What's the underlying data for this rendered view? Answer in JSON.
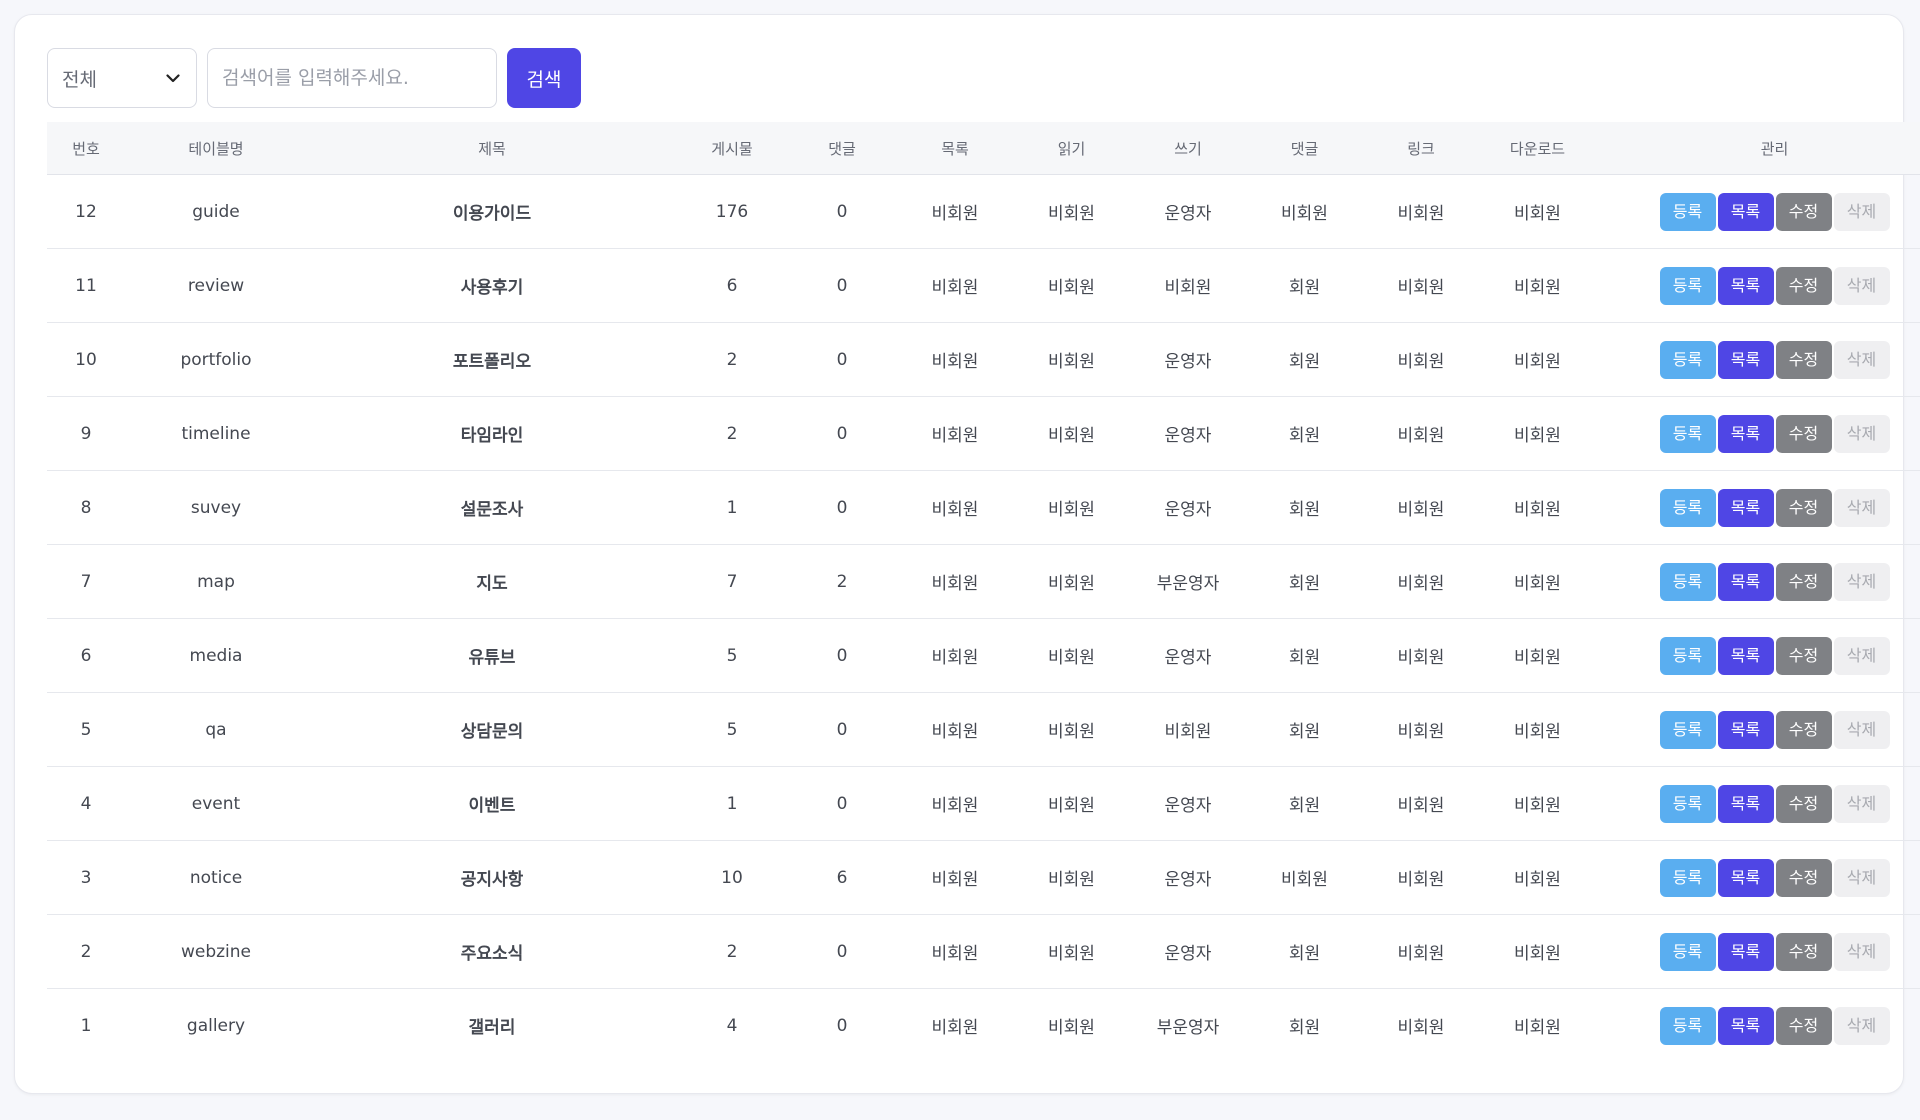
{
  "search": {
    "category_selected": "전체",
    "placeholder": "검색어를 입력해주세요.",
    "value": "",
    "button_label": "검색"
  },
  "table": {
    "headers": [
      "번호",
      "테이블명",
      "제목",
      "게시물",
      "댓글",
      "목록",
      "읽기",
      "쓰기",
      "댓글",
      "링크",
      "다운로드",
      "관리"
    ],
    "action_labels": {
      "register": "등록",
      "list": "목록",
      "edit": "수정",
      "delete": "삭제"
    },
    "rows": [
      {
        "no": "12",
        "table_name": "guide",
        "title": "이용가이드",
        "posts": "176",
        "comments": "0",
        "list": "비회원",
        "read": "비회원",
        "write": "운영자",
        "comment": "비회원",
        "link": "비회원",
        "download": "비회원"
      },
      {
        "no": "11",
        "table_name": "review",
        "title": "사용후기",
        "posts": "6",
        "comments": "0",
        "list": "비회원",
        "read": "비회원",
        "write": "비회원",
        "comment": "회원",
        "link": "비회원",
        "download": "비회원"
      },
      {
        "no": "10",
        "table_name": "portfolio",
        "title": "포트폴리오",
        "posts": "2",
        "comments": "0",
        "list": "비회원",
        "read": "비회원",
        "write": "운영자",
        "comment": "회원",
        "link": "비회원",
        "download": "비회원"
      },
      {
        "no": "9",
        "table_name": "timeline",
        "title": "타임라인",
        "posts": "2",
        "comments": "0",
        "list": "비회원",
        "read": "비회원",
        "write": "운영자",
        "comment": "회원",
        "link": "비회원",
        "download": "비회원"
      },
      {
        "no": "8",
        "table_name": "suvey",
        "title": "설문조사",
        "posts": "1",
        "comments": "0",
        "list": "비회원",
        "read": "비회원",
        "write": "운영자",
        "comment": "회원",
        "link": "비회원",
        "download": "비회원"
      },
      {
        "no": "7",
        "table_name": "map",
        "title": "지도",
        "posts": "7",
        "comments": "2",
        "list": "비회원",
        "read": "비회원",
        "write": "부운영자",
        "comment": "회원",
        "link": "비회원",
        "download": "비회원"
      },
      {
        "no": "6",
        "table_name": "media",
        "title": "유튜브",
        "posts": "5",
        "comments": "0",
        "list": "비회원",
        "read": "비회원",
        "write": "운영자",
        "comment": "회원",
        "link": "비회원",
        "download": "비회원"
      },
      {
        "no": "5",
        "table_name": "qa",
        "title": "상담문의",
        "posts": "5",
        "comments": "0",
        "list": "비회원",
        "read": "비회원",
        "write": "비회원",
        "comment": "회원",
        "link": "비회원",
        "download": "비회원"
      },
      {
        "no": "4",
        "table_name": "event",
        "title": "이벤트",
        "posts": "1",
        "comments": "0",
        "list": "비회원",
        "read": "비회원",
        "write": "운영자",
        "comment": "회원",
        "link": "비회원",
        "download": "비회원"
      },
      {
        "no": "3",
        "table_name": "notice",
        "title": "공지사항",
        "posts": "10",
        "comments": "6",
        "list": "비회원",
        "read": "비회원",
        "write": "운영자",
        "comment": "비회원",
        "link": "비회원",
        "download": "비회원"
      },
      {
        "no": "2",
        "table_name": "webzine",
        "title": "주요소식",
        "posts": "2",
        "comments": "0",
        "list": "비회원",
        "read": "비회원",
        "write": "운영자",
        "comment": "회원",
        "link": "비회원",
        "download": "비회원"
      },
      {
        "no": "1",
        "table_name": "gallery",
        "title": "갤러리",
        "posts": "4",
        "comments": "0",
        "list": "비회원",
        "read": "비회원",
        "write": "부운영자",
        "comment": "회원",
        "link": "비회원",
        "download": "비회원"
      }
    ]
  },
  "colors": {
    "accent": "#4f46e5",
    "register_button": "#5aaef0",
    "list_button": "#4f46e5",
    "edit_button": "#7f8185",
    "delete_button": "#efeff1",
    "header_background": "#f6f7f9"
  },
  "icons": {
    "select_toggle": "chevron-down-icon"
  }
}
